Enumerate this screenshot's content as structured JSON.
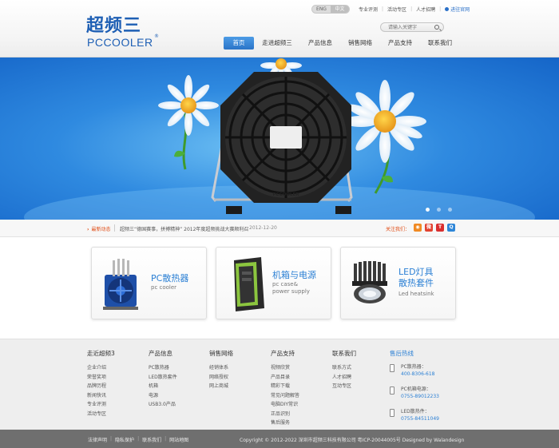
{
  "brand": {
    "name_cn": "超频三",
    "name_en": "PCCOOLER",
    "reg_mark": "®"
  },
  "topbar": {
    "lang_options": [
      "ENG",
      "中文"
    ],
    "links": [
      "专业评测",
      "活动专区",
      "人才招聘"
    ],
    "official": "进驻官网"
  },
  "search": {
    "placeholder": "请输入关键字"
  },
  "nav": {
    "items": [
      "首页",
      "走进超频三",
      "产品信息",
      "销售网络",
      "产品支持",
      "联系我们"
    ],
    "active_index": 0
  },
  "banner": {
    "product_label": "PCCOOLER",
    "slides": 3,
    "active_slide": 0
  },
  "news": {
    "label": "最新动态",
    "text": "超频三“德国赛事，拼搏精神” 2012年度超频挑战大赛顺利召",
    "date": "2012-12-20",
    "follow_label": "关注我们："
  },
  "social_icons": [
    {
      "name": "rss-icon",
      "glyph": "◉",
      "color": "#f08a24"
    },
    {
      "name": "weibo-icon",
      "glyph": "微",
      "color": "#e2422f"
    },
    {
      "name": "tencent-weibo-icon",
      "glyph": "T",
      "color": "#d92e2e"
    },
    {
      "name": "qzone-icon",
      "glyph": "Q",
      "color": "#2e86d8"
    }
  ],
  "products": [
    {
      "title": "PC散热器",
      "sub": "pc cooler"
    },
    {
      "title": "机箱与电源",
      "sub_line1": "pc case&",
      "sub_line2": "power supply"
    },
    {
      "title_line1": "LED灯具",
      "title_line2": "散热套件",
      "sub": "Led heatsink"
    }
  ],
  "footer": {
    "columns": [
      {
        "title": "走近超频3",
        "items": [
          "企业介绍",
          "荣誉奖项",
          "品牌历程",
          "新闻快讯",
          "专业评测",
          "活动专区"
        ]
      },
      {
        "title": "产品信息",
        "items": [
          "PC散热器",
          "LED散热套件",
          "机箱",
          "电源",
          "USB3.0产品"
        ]
      },
      {
        "title": "销售网络",
        "items": [
          "经销体系",
          "网络授权",
          "网上商城"
        ]
      },
      {
        "title": "产品支持",
        "items": [
          "视频欣赏",
          "产品目录",
          "精彩下载",
          "常见问题解答",
          "电脑DIY常识",
          "正品识别",
          "售后服务"
        ]
      },
      {
        "title": "联系我们",
        "items": [
          "联系方式",
          "人才招聘",
          "互动专区"
        ]
      }
    ],
    "hotline": {
      "title": "售后热线",
      "items": [
        {
          "label": "PC散热器：",
          "number": "400-8306-618"
        },
        {
          "label": "PC机箱电源：",
          "number": "0755-89012233"
        },
        {
          "label": "LED散热件：",
          "number": "0755-84511049"
        }
      ]
    }
  },
  "bottombar": {
    "links": [
      "法律声明",
      "隐私保护",
      "联系我们",
      "网站地图"
    ],
    "copyright": "Copyright © 2012-2022  深圳市超频三科技有限公司      粤ICP-20044005号      Designed by Walandesign"
  },
  "colors": {
    "accent": "#2a7fd4",
    "nav_active": "#2b74c7",
    "news_label": "#e04a12",
    "banner_blue": "#2f8ae0"
  }
}
